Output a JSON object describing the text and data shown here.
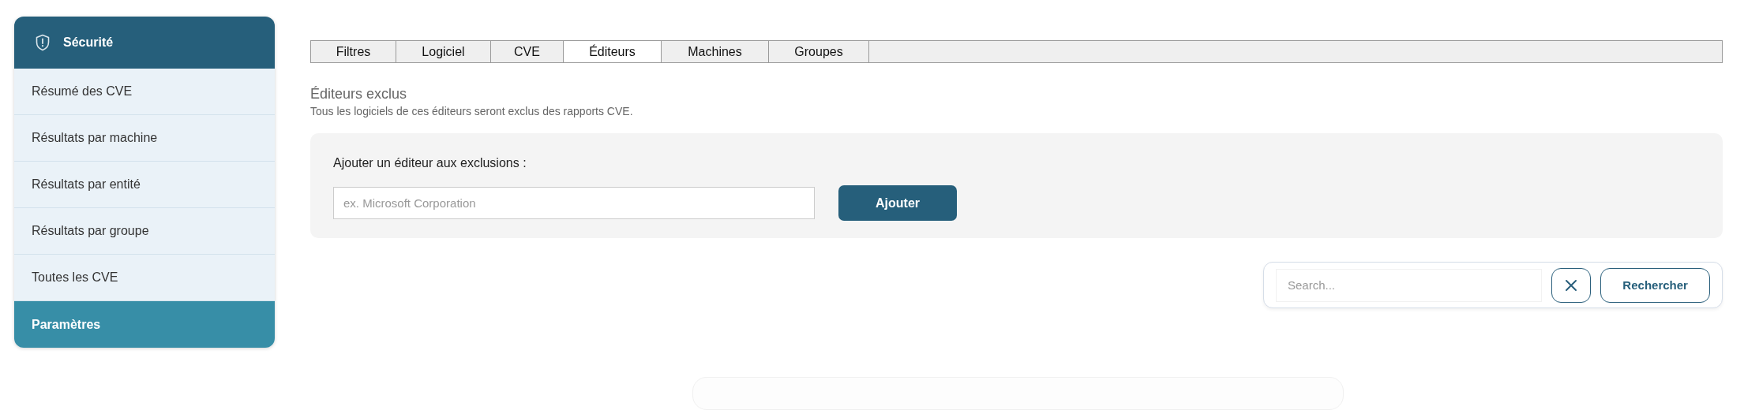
{
  "sidebar": {
    "title": "Sécurité",
    "items": [
      {
        "label": "Résumé des CVE",
        "selected": false
      },
      {
        "label": "Résultats par machine",
        "selected": false
      },
      {
        "label": "Résultats par entité",
        "selected": false
      },
      {
        "label": "Résultats par groupe",
        "selected": false
      },
      {
        "label": "Toutes les CVE",
        "selected": false
      },
      {
        "label": "Paramètres",
        "selected": true
      }
    ]
  },
  "tabs": [
    {
      "label": "Filtres",
      "selected": false
    },
    {
      "label": "Logiciel",
      "selected": false
    },
    {
      "label": "CVE",
      "selected": false
    },
    {
      "label": "Éditeurs",
      "selected": true
    },
    {
      "label": "Machines",
      "selected": false
    },
    {
      "label": "Groupes",
      "selected": false
    }
  ],
  "section": {
    "title": "Éditeurs exclus",
    "description": "Tous les logiciels de ces éditeurs seront exclus des rapports CVE."
  },
  "add_form": {
    "label": "Ajouter un éditeur aux exclusions :",
    "placeholder": "ex. Microsoft Corporation",
    "button": "Ajouter"
  },
  "search": {
    "placeholder": "Search...",
    "button": "Rechercher"
  }
}
